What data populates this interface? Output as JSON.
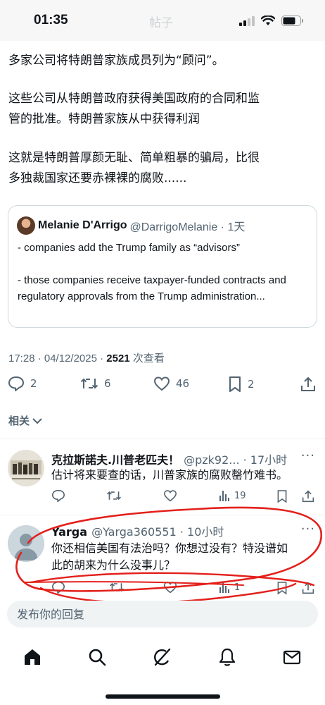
{
  "status_bar": {
    "time": "01:35",
    "nav_title_ghost": "帖子"
  },
  "tweet": {
    "lines": [
      "多家公司将特朗普家族成员列为“顾问”。",
      "这些公司从特朗普政府获得美国政府的合同和监",
      "管的批准。特朗普家族从中获得利润",
      "这就是特朗普厚颜无耻、简单粗暴的骗局，比很",
      "多独裁国家还要赤裸裸的腐败......"
    ],
    "timestamp": "17:28 · 04/12/2025 · ",
    "views_count": "2521",
    "views_label": " 次查看",
    "actions": {
      "replies": "2",
      "retweets": "6",
      "likes": "46",
      "bookmarks": "2"
    }
  },
  "quote": {
    "name": "Melanie D'Arrigo",
    "handle_time": "@DarrigoMelanie · 1天",
    "paragraph1": "- companies add the Trump family as “advisors”",
    "paragraph2": "- those companies receive taxpayer-funded contracts and regulatory approvals from the Trump administration..."
  },
  "related_label": "相关",
  "replies": [
    {
      "name": "克拉斯諾夫.川普老匹夫！",
      "handle_time": "@pzk92... · 17小时",
      "text": "估计将来要查的话，川普家族的腐败罄竹难书。",
      "replies": "",
      "retweets": "",
      "likes": "",
      "views": "19"
    },
    {
      "name": "Yarga",
      "handle_time": "@Yarga360551 · 10小时",
      "text_line1": "你还相信美国有法治吗？你想过没有？特没谱如",
      "text_line2": "此的胡来为什么没事儿？",
      "views": "1"
    }
  ],
  "reply_input": {
    "placeholder": "发布你的回复"
  },
  "colors": {
    "text": "#0f1419",
    "secondary": "#536471",
    "border": "#cfd9de",
    "annotation_red": "#e3201b"
  },
  "icons": [
    "home-icon",
    "search-icon",
    "grok-icon",
    "bell-icon",
    "mail-icon"
  ]
}
